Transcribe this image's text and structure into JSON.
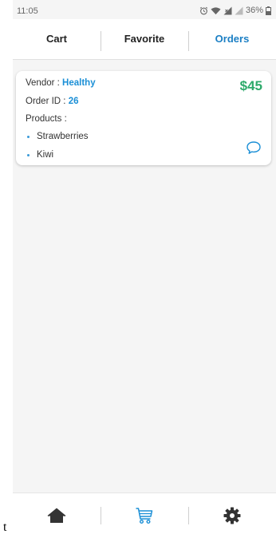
{
  "status_bar": {
    "time": "11:05",
    "battery_percent": "36%",
    "icons": [
      "alarm-icon",
      "wifi-icon",
      "signal-icon",
      "battery-icon"
    ]
  },
  "tabs": [
    {
      "label": "Cart",
      "active": false
    },
    {
      "label": "Favorite",
      "active": false
    },
    {
      "label": "Orders",
      "active": true
    }
  ],
  "order": {
    "vendor_label": "Vendor : ",
    "vendor_name": "Healthy",
    "order_id_label": "Order ID : ",
    "order_id": "26",
    "price": "$45",
    "products_label": "Products :",
    "products": [
      "Strawberries",
      "Kiwi"
    ],
    "chat_icon": "chat-bubble-icon"
  },
  "bottom_nav": [
    {
      "icon": "home-icon",
      "active": false
    },
    {
      "icon": "cart-icon",
      "active": true
    },
    {
      "icon": "settings-gear-icon",
      "active": false
    }
  ],
  "edge_text": "t",
  "colors": {
    "accent_blue": "#1b8fd6",
    "price_green": "#2eaa6b",
    "active_tab": "#1b7fc4",
    "background": "#f5f5f5"
  }
}
